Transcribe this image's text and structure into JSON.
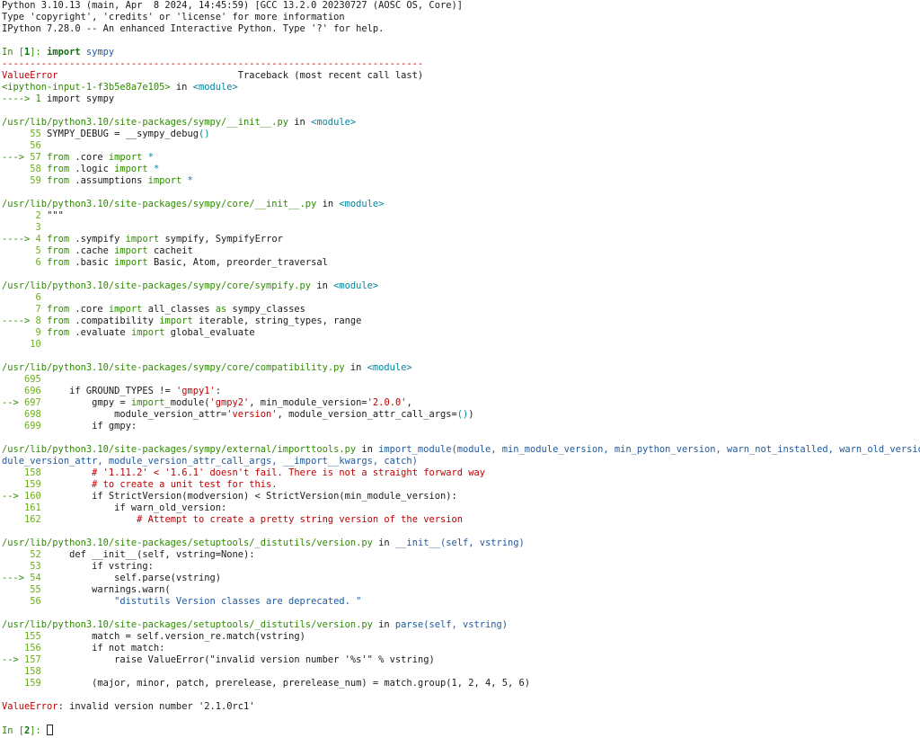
{
  "banner": {
    "line1": "Python 3.10.13 (main, Apr  8 2024, 14:45:59) [GCC 13.2.0 20230727 (AOSC OS, Core)]",
    "line2": "Type 'copyright', 'credits' or 'license' for more information",
    "line3": "IPython 7.28.0 -- An enhanced Interactive Python. Type '?' for help."
  },
  "prompt1": {
    "in": "In [",
    "num": "1",
    "close": "]: ",
    "code": "import sympy"
  },
  "separator": "---------------------------------------------------------------------------",
  "tb_header": {
    "err": "ValueError",
    "gap": "                                ",
    "title": "Traceback (most recent call last)"
  },
  "tb_input": {
    "file": "<ipython-input-1-f3b5e8a7e105>",
    "in": " in ",
    "module": "<module>"
  },
  "tb_input_line": {
    "arrow": "----> 1 ",
    "code": "import sympy"
  },
  "frames": [
    {
      "file": "/usr/lib/python3.10/site-packages/sympy/__init__.py",
      "func": "<module>",
      "lines": [
        {
          "arrow": "     ",
          "num": "55",
          "pre": " SYMPY_DEBUG = __sympy_debug",
          "post": "()"
        },
        {
          "arrow": "     ",
          "num": "56",
          "pre": "",
          "post": ""
        },
        {
          "arrow": "---> ",
          "num": "57",
          "pre": " from",
          "post": " .core import *"
        },
        {
          "arrow": "     ",
          "num": "58",
          "pre": " from",
          "post": " .logic import *"
        },
        {
          "arrow": "     ",
          "num": "59",
          "pre": " from",
          "post": " .assumptions import *"
        }
      ]
    },
    {
      "file": "/usr/lib/python3.10/site-packages/sympy/core/__init__.py",
      "func": "<module>",
      "lines": [
        {
          "arrow": "      ",
          "num": "2",
          "pre": " \"\"\"",
          "post": ""
        },
        {
          "arrow": "      ",
          "num": "3",
          "pre": "",
          "post": ""
        },
        {
          "arrow": "----> ",
          "num": "4",
          "pre": " from",
          "post": " .sympify import sympify, SympifyError"
        },
        {
          "arrow": "      ",
          "num": "5",
          "pre": " from",
          "post": " .cache import cacheit"
        },
        {
          "arrow": "      ",
          "num": "6",
          "pre": " from",
          "post": " .basic import Basic, Atom, preorder_traversal"
        }
      ]
    },
    {
      "file": "/usr/lib/python3.10/site-packages/sympy/core/sympify.py",
      "func": "<module>",
      "lines": [
        {
          "arrow": "      ",
          "num": "6",
          "pre": "",
          "post": ""
        },
        {
          "arrow": "      ",
          "num": "7",
          "pre": " from",
          "post": " .core import all_classes as sympy_classes"
        },
        {
          "arrow": "----> ",
          "num": "8",
          "pre": " from",
          "post": " .compatibility import iterable, string_types, range"
        },
        {
          "arrow": "      ",
          "num": "9",
          "pre": " from",
          "post": " .evaluate import global_evaluate"
        },
        {
          "arrow": "     ",
          "num": "10",
          "pre": "",
          "post": ""
        }
      ]
    },
    {
      "file": "/usr/lib/python3.10/site-packages/sympy/core/compatibility.py",
      "func": "<module>",
      "lines": [
        {
          "arrow": "    ",
          "num": "695",
          "pre": "",
          "post": ""
        },
        {
          "arrow": "    ",
          "num": "696",
          "pre": "     if GROUND_TYPES != ",
          "post": "'gmpy1':"
        },
        {
          "arrow": "--> ",
          "num": "697",
          "pre": "         gmpy = import_module('gmpy2', min_module_version='2.0.0',",
          "post": ""
        },
        {
          "arrow": "    ",
          "num": "698",
          "pre": "             module_version_attr='version', module_version_attr_call_args=())",
          "post": ""
        },
        {
          "arrow": "    ",
          "num": "699",
          "pre": "         if gmpy:",
          "post": ""
        }
      ]
    }
  ],
  "importtools": {
    "file": "/usr/lib/python3.10/site-packages/sympy/external/importtools.py",
    "sig1": "import_module(module, min_module_version, min_python_version, warn_not_installed, warn_old_version,",
    "sig2": "dule_version_attr, module_version_attr_call_args, __import__kwargs, catch)",
    "lines": [
      {
        "arrow": "    ",
        "num": "158",
        "code": "         # '1.11.2' < '1.6.1' doesn't fail. There is not a straight forward way"
      },
      {
        "arrow": "    ",
        "num": "159",
        "code": "         # to create a unit test for this."
      },
      {
        "arrow": "--> ",
        "num": "160",
        "code": "         if StrictVersion(modversion) < StrictVersion(min_module_version):"
      },
      {
        "arrow": "    ",
        "num": "161",
        "code": "             if warn_old_version:"
      },
      {
        "arrow": "    ",
        "num": "162",
        "code": "                 # Attempt to create a pretty string version of the version"
      }
    ]
  },
  "version_init": {
    "file": "/usr/lib/python3.10/site-packages/setuptools/_distutils/version.py",
    "func": "__init__(self, vstring)",
    "lines": [
      {
        "arrow": "     ",
        "num": "52",
        "code": "     def __init__(self, vstring=None):"
      },
      {
        "arrow": "     ",
        "num": "53",
        "code": "         if vstring:"
      },
      {
        "arrow": "---> ",
        "num": "54",
        "code": "             self.parse(vstring)"
      },
      {
        "arrow": "     ",
        "num": "55",
        "code": "         warnings.warn("
      },
      {
        "arrow": "     ",
        "num": "56",
        "code": "             \"distutils Version classes are deprecated. \""
      }
    ]
  },
  "version_parse": {
    "file": "/usr/lib/python3.10/site-packages/setuptools/_distutils/version.py",
    "func": "parse(self, vstring)",
    "lines": [
      {
        "arrow": "    ",
        "num": "155",
        "code": "         match = self.version_re.match(vstring)"
      },
      {
        "arrow": "    ",
        "num": "156",
        "code": "         if not match:"
      },
      {
        "arrow": "--> ",
        "num": "157",
        "code": "             raise ValueError(\"invalid version number '%s'\" % vstring)"
      },
      {
        "arrow": "    ",
        "num": "158",
        "code": ""
      },
      {
        "arrow": "    ",
        "num": "159",
        "code": "         (major, minor, patch, prerelease, prerelease_num) = match.group(1, 2, 4, 5, 6)"
      }
    ]
  },
  "final_error": {
    "type": "ValueError",
    "msg": ": invalid version number '2.1.0rc1'"
  },
  "prompt2": {
    "in": "In [",
    "num": "2",
    "close": "]: "
  }
}
